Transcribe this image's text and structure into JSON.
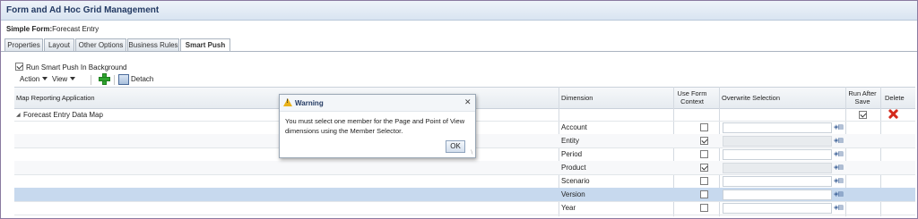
{
  "window": {
    "title": "Form and Ad Hoc Grid Management"
  },
  "form": {
    "label": "Simple Form:",
    "name": "Forecast Entry"
  },
  "tabs": [
    {
      "label": "Properties",
      "active": false
    },
    {
      "label": "Layout",
      "active": false
    },
    {
      "label": "Other Options",
      "active": false
    },
    {
      "label": "Business Rules",
      "active": false
    },
    {
      "label": "Smart Push",
      "active": true
    }
  ],
  "run_in_background": {
    "label": "Run Smart Push In Background",
    "checked": true
  },
  "toolbar": {
    "action_label": "Action",
    "view_label": "View",
    "add_icon": "add-icon",
    "detach_label": "Detach"
  },
  "grid": {
    "headers": {
      "map_app": "Map Reporting Application",
      "dimension": "Dimension",
      "use_form_context_1": "Use Form",
      "use_form_context_2": "Context",
      "overwrite": "Overwrite Selection",
      "run_after_save_1": "Run After",
      "run_after_save_2": "Save",
      "delete": "Delete"
    },
    "map_row": {
      "name": "Forecast Entry Data Map",
      "run_after_save": true
    },
    "rows": [
      {
        "dimension": "Account",
        "use_form_context": false,
        "overwrite_enabled": true
      },
      {
        "dimension": "Entity",
        "use_form_context": true,
        "overwrite_enabled": false
      },
      {
        "dimension": "Period",
        "use_form_context": false,
        "overwrite_enabled": true
      },
      {
        "dimension": "Product",
        "use_form_context": true,
        "overwrite_enabled": false
      },
      {
        "dimension": "Scenario",
        "use_form_context": false,
        "overwrite_enabled": true
      },
      {
        "dimension": "Version",
        "use_form_context": false,
        "overwrite_enabled": true,
        "selected": true
      },
      {
        "dimension": "Year",
        "use_form_context": false,
        "overwrite_enabled": true
      }
    ]
  },
  "dialog": {
    "title": "Warning",
    "message": "You must select one member for the Page and Point of View dimensions using the Member Selector.",
    "ok_label": "OK"
  },
  "colors": {
    "accent": "#233a63",
    "selected_row": "#c7d9ee",
    "warning": "#e9b21a",
    "delete": "#d42a1c",
    "add": "#2fa52f"
  }
}
